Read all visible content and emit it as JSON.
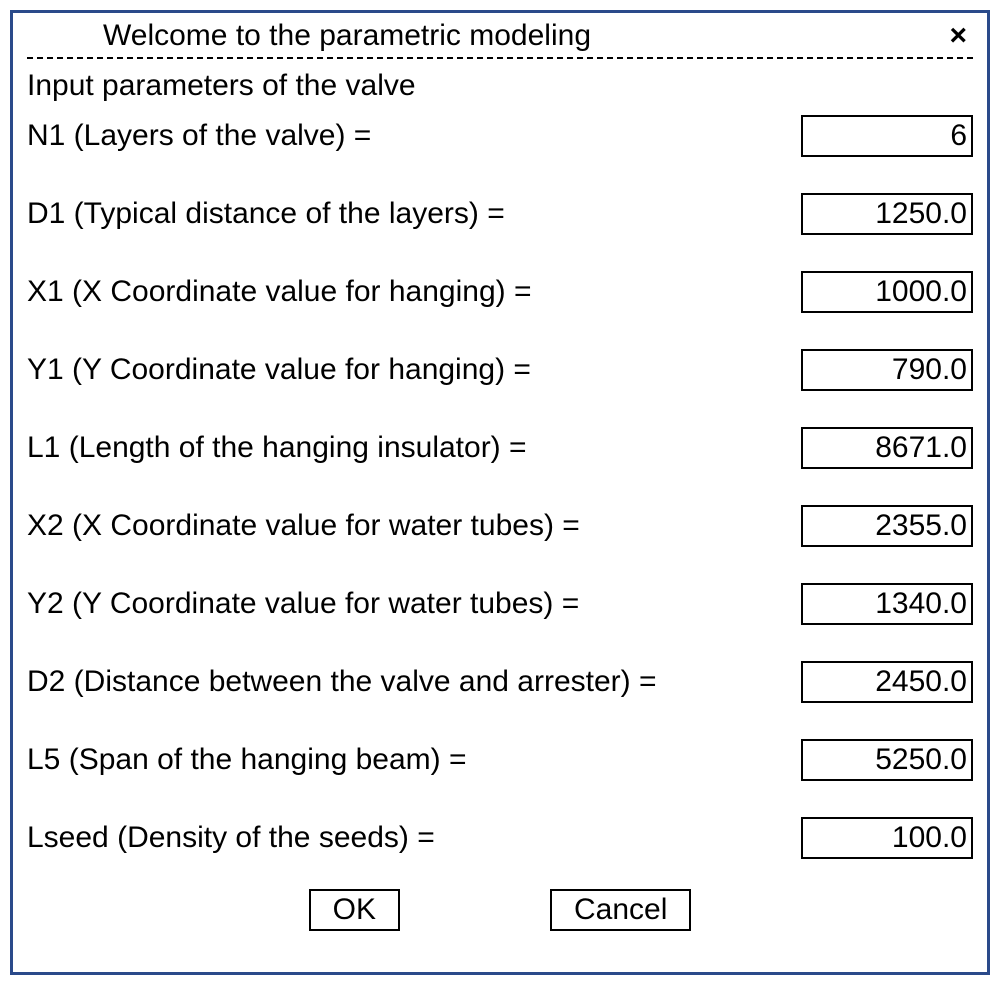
{
  "titlebar": {
    "title": "Welcome to the parametric modeling",
    "close": "×"
  },
  "section_header": "Input parameters of the valve",
  "rows": [
    {
      "label": "N1 (Layers of the valve) =",
      "value": "6"
    },
    {
      "label": "D1 (Typical distance of the layers) =",
      "value": "1250.0"
    },
    {
      "label": "X1 (X Coordinate value for hanging) =",
      "value": "1000.0"
    },
    {
      "label": "Y1 (Y Coordinate value for hanging) =",
      "value": "790.0"
    },
    {
      "label": "L1 (Length of the hanging insulator) =",
      "value": "8671.0"
    },
    {
      "label": "X2 (X Coordinate value for water tubes) =",
      "value": "2355.0"
    },
    {
      "label": "Y2 (Y Coordinate value for water tubes) =",
      "value": "1340.0"
    },
    {
      "label": "D2 (Distance between the valve and arrester) =",
      "value": "2450.0"
    },
    {
      "label": "L5 (Span of the hanging beam) =",
      "value": "5250.0"
    },
    {
      "label": "Lseed (Density of the seeds) =",
      "value": "100.0"
    }
  ],
  "buttons": {
    "ok": "OK",
    "cancel": "Cancel"
  }
}
